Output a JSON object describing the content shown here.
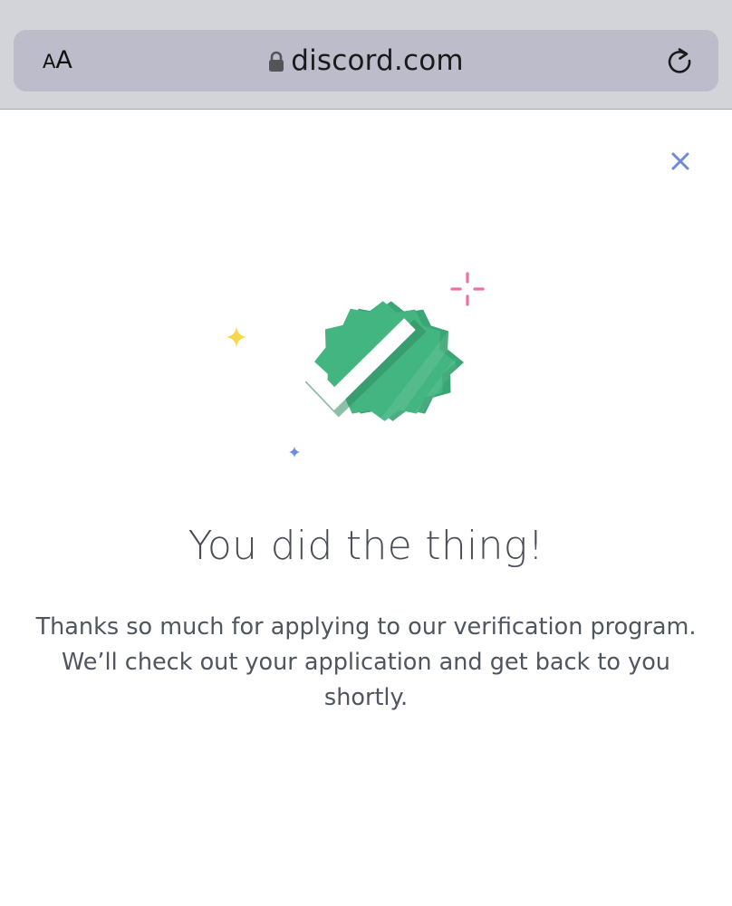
{
  "browser": {
    "text_size_small": "A",
    "text_size_large": "A",
    "url": "discord.com",
    "icons": {
      "lock": "lock-icon",
      "reload": "reload-icon"
    }
  },
  "modal": {
    "close_icon": "close-icon",
    "badge_icon": "verified-badge-icon",
    "title": "You did the thing!",
    "description_lines": [
      "Thanks so much for applying to our verification program.",
      "We’ll check out your application and get back to you",
      "shortly."
    ]
  },
  "colors": {
    "chrome_bg": "#d3d3da",
    "address_bar_bg": "#bcbccb",
    "badge_green": "#43b581",
    "badge_green_dark": "#3aa575",
    "close_blue": "#7289da",
    "title_text": "#4a4d55",
    "body_text": "#4f5660",
    "sparkle_yellow": "#f6d84a",
    "sparkle_pink": "#ef6fa4",
    "sparkle_blue": "#6a8be8"
  }
}
